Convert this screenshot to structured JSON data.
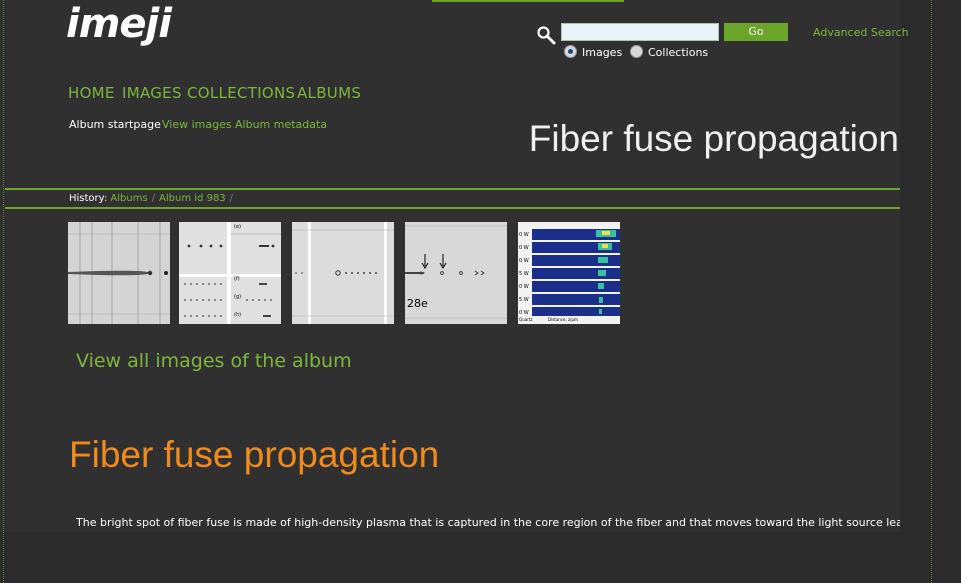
{
  "header": {
    "logo": "imeji",
    "search": {
      "placeholder": "",
      "value": "",
      "go_label": "Go",
      "advanced_label": "Advanced Search"
    },
    "scope": {
      "images_label": "Images",
      "collections_label": "Collections",
      "selected": "Images"
    }
  },
  "nav": {
    "home": "HOME",
    "images": "IMAGES",
    "collections": "COLLECTIONS",
    "albums": "ALBUMS"
  },
  "subnav": {
    "startpage": "Album startpage",
    "view_images": "View images",
    "metadata": "Album metadata"
  },
  "page": {
    "title": "Fiber fuse propagation"
  },
  "history": {
    "label": "History:",
    "items": [
      "Albums",
      "Album id 983"
    ]
  },
  "thumbnails": [
    {
      "label": ""
    },
    {
      "label": ""
    },
    {
      "label": ""
    },
    {
      "label": "28e"
    },
    {
      "label": ""
    }
  ],
  "album": {
    "view_all_label": "View all images of the album",
    "title": "Fiber fuse propagation",
    "description": "The bright spot of fiber fuse is made of high-density plasma that is captured in the core region of the fiber and that moves toward the light source leaving a void tra"
  },
  "colors": {
    "accent": "#7ab83c",
    "accent_dark": "#6aa52a",
    "title_orange": "#f08a1c",
    "background": "#303030"
  }
}
